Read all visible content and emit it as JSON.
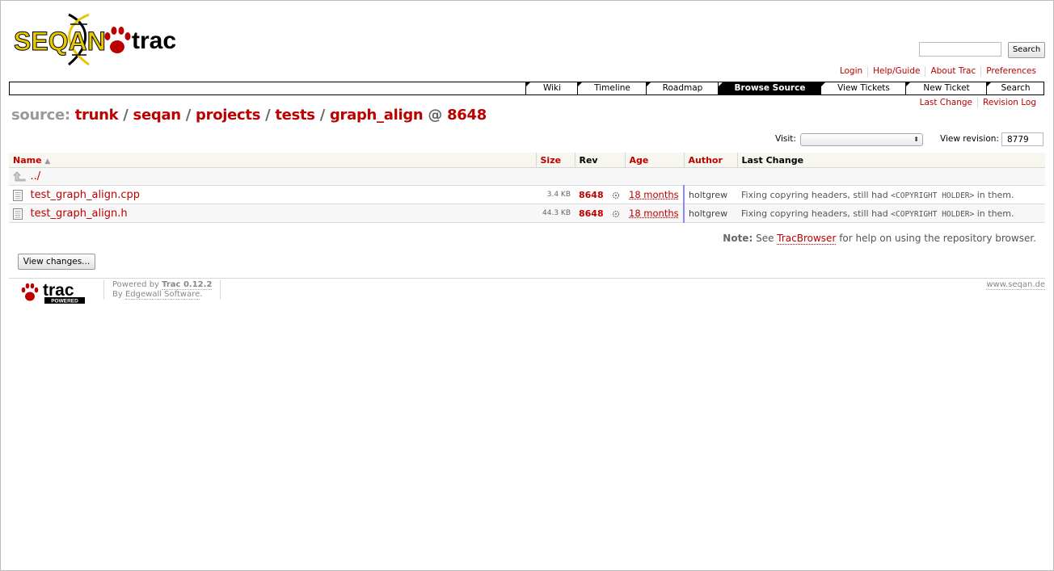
{
  "header": {
    "logo_text_left": "SEQAN",
    "logo_text_right": "trac",
    "search_button": "Search",
    "search_placeholder": ""
  },
  "metanav": [
    "Login",
    "Help/Guide",
    "About Trac",
    "Preferences"
  ],
  "mainnav": {
    "tabs": [
      "Wiki",
      "Timeline",
      "Roadmap",
      "Browse Source",
      "View Tickets",
      "New Ticket",
      "Search"
    ],
    "active": "Browse Source"
  },
  "ctxtnav": [
    "Last Change",
    "Revision Log"
  ],
  "path": {
    "label": "source:",
    "segments": [
      "trunk",
      "seqan",
      "projects",
      "tests",
      "graph_align"
    ],
    "at": "@",
    "revision": "8648"
  },
  "controls": {
    "visit_label": "Visit:",
    "visit_value": "",
    "view_revision_label": "View revision:",
    "view_revision_value": "8779"
  },
  "listing": {
    "headers": [
      "Name",
      "Size",
      "Rev",
      "Age",
      "Author",
      "Last Change"
    ],
    "sort_indicator": "▲",
    "parent_link": "../",
    "rows": [
      {
        "name": "test_graph_align.cpp",
        "size": "3.4 KB",
        "rev": "8648",
        "age": "18 months",
        "author": "holtgrew",
        "change_pre": "Fixing copyring headers, still had ",
        "change_code": "<COPYRIGHT HOLDER>",
        "change_post": " in them."
      },
      {
        "name": "test_graph_align.h",
        "size": "44.3 KB",
        "rev": "8648",
        "age": "18 months",
        "author": "holtgrew",
        "change_pre": "Fixing copyring headers, still had ",
        "change_code": "<COPYRIGHT HOLDER>",
        "change_post": " in them."
      }
    ]
  },
  "note": {
    "label": "Note:",
    "pre": "See",
    "link": "TracBrowser",
    "post": "for help on using the repository browser."
  },
  "view_changes_button": "View changes...",
  "footer": {
    "trac_logo_text": "trac",
    "trac_logo_sub": "POWERED",
    "powered_by": "Powered by",
    "trac_version": "Trac 0.12.2",
    "by": "By",
    "edgewall": "Edgewall Software",
    "site": "www.seqan.de"
  },
  "colors": {
    "link": "#bb0000",
    "header_bg": "#f7f7f0",
    "active_tab": "#000000"
  }
}
